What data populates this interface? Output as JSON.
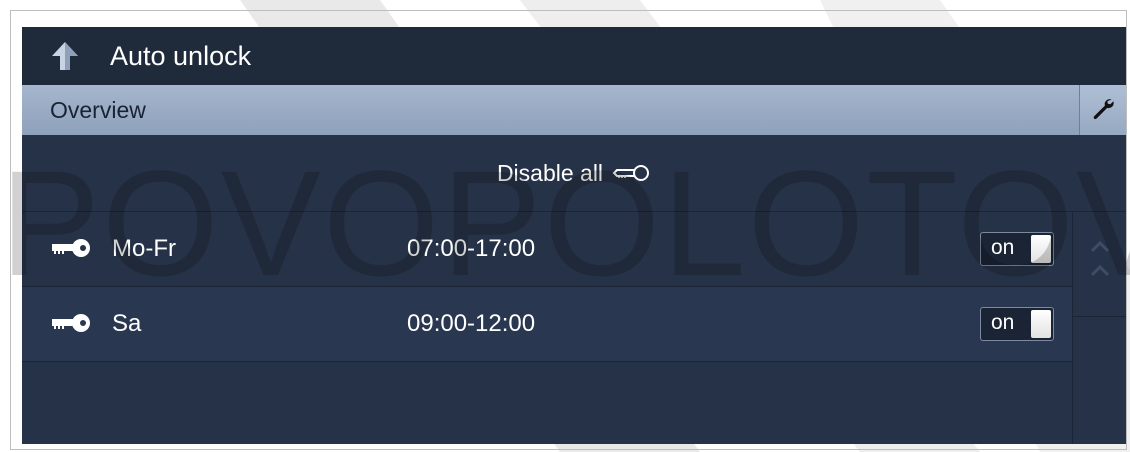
{
  "header": {
    "title": "Auto unlock",
    "back_icon": "arrow-up-icon"
  },
  "subheader": {
    "label": "Overview",
    "settings_icon": "wrench-icon"
  },
  "disable_all": {
    "label": "Disable all",
    "icon": "key-outline-icon"
  },
  "schedules": [
    {
      "day": "Mo-Fr",
      "time": "07:00-17:00",
      "toggle": "on",
      "icon": "key-icon"
    },
    {
      "day": "Sa",
      "time": "09:00-12:00",
      "toggle": "on",
      "icon": "key-icon"
    }
  ],
  "scroll": {
    "icon": "chevron-up-icon"
  },
  "watermark": "POVOPOLOTOVAR",
  "colors": {
    "panel_bg": "#263247",
    "titlebar_bg": "#1f2a3b",
    "overview_bar": "#9aadc6",
    "text": "#ffffff"
  }
}
